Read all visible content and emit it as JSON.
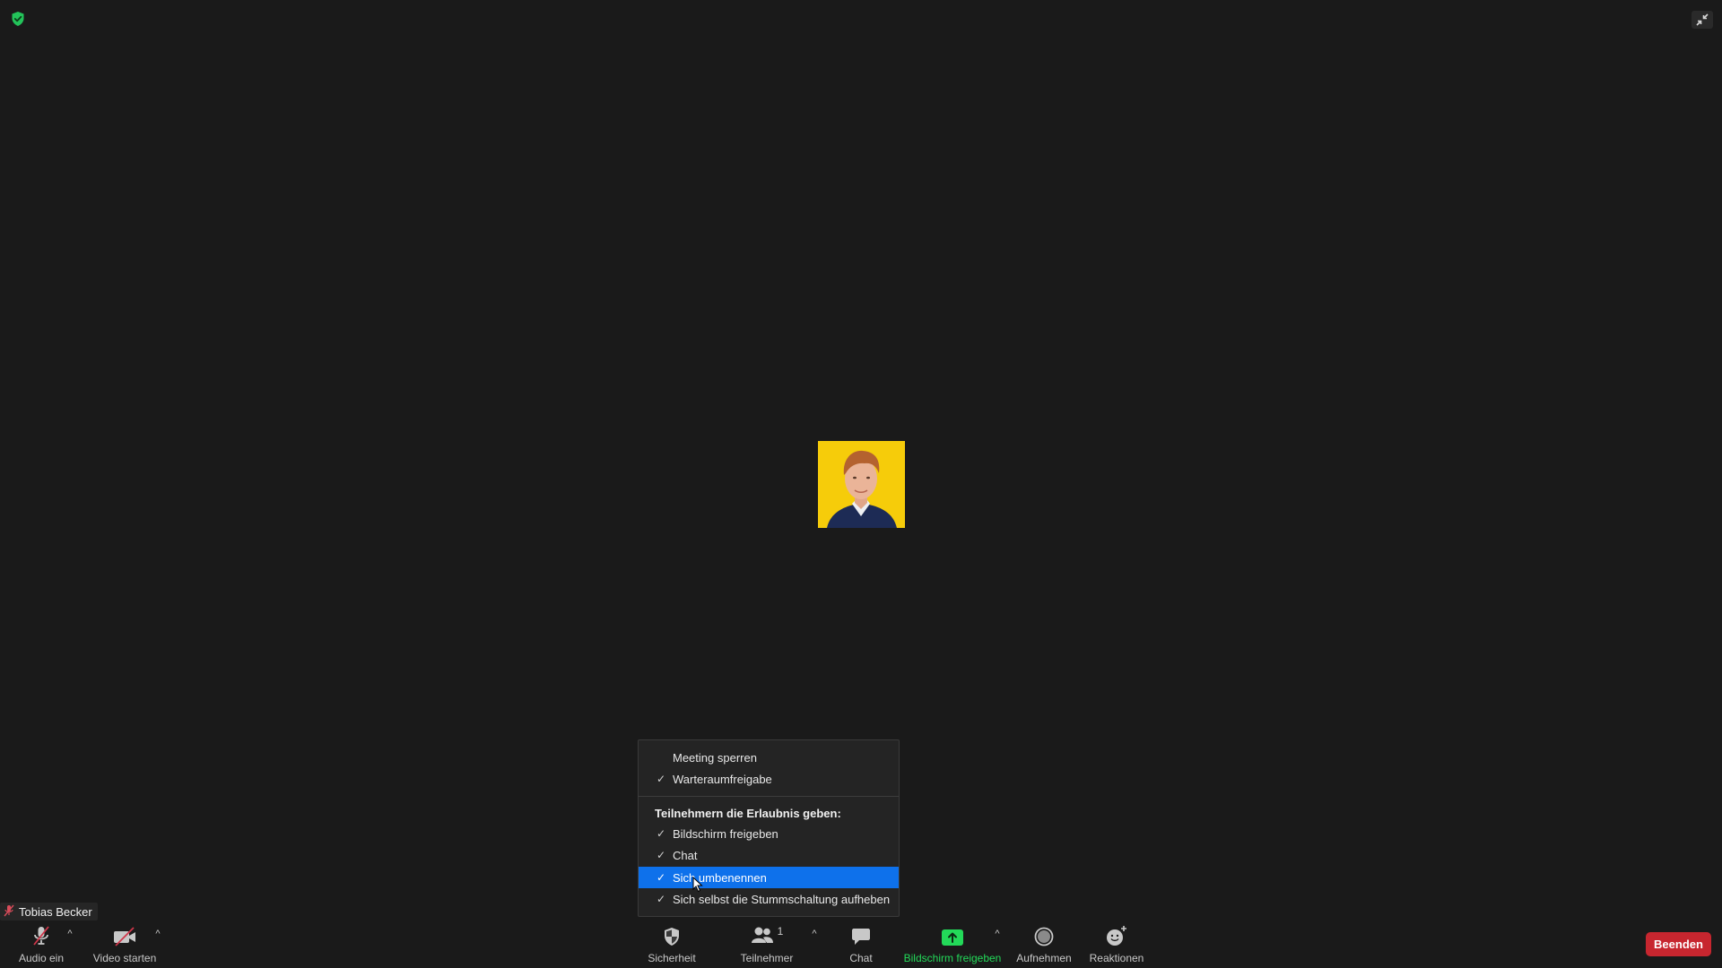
{
  "window": {
    "encryption_icon": "shield-check-icon",
    "exit_fullscreen_icon": "exit-fullscreen-icon"
  },
  "participant": {
    "name": "Tobias Becker",
    "muted_icon": "mic-muted-icon",
    "avatar_background": "#f6cc0a"
  },
  "security_menu": {
    "items": [
      {
        "label": "Meeting sperren",
        "checked": false
      },
      {
        "label": "Warteraumfreigabe",
        "checked": true
      }
    ],
    "section_heading": "Teilnehmern die Erlaubnis geben:",
    "permissions": [
      {
        "label": "Bildschirm freigeben",
        "checked": true,
        "highlighted": false
      },
      {
        "label": "Chat",
        "checked": true,
        "highlighted": false
      },
      {
        "label": "Sich umbenennen",
        "checked": true,
        "highlighted": true
      },
      {
        "label": "Sich selbst die Stummschaltung aufheben",
        "checked": true,
        "highlighted": false
      }
    ],
    "check_glyph": "✓",
    "highlight_color": "#0e71eb"
  },
  "toolbar": {
    "audio_label": "Audio ein",
    "video_label": "Video starten",
    "security_label": "Sicherheit",
    "participants_label": "Teilnehmer",
    "participants_count": "1",
    "chat_label": "Chat",
    "share_label": "Bildschirm freigeben",
    "record_label": "Aufnehmen",
    "reactions_label": "Reaktionen",
    "caret_glyph": "^",
    "end_label": "Beenden",
    "share_color": "#23d959",
    "end_color": "#c7262f"
  }
}
